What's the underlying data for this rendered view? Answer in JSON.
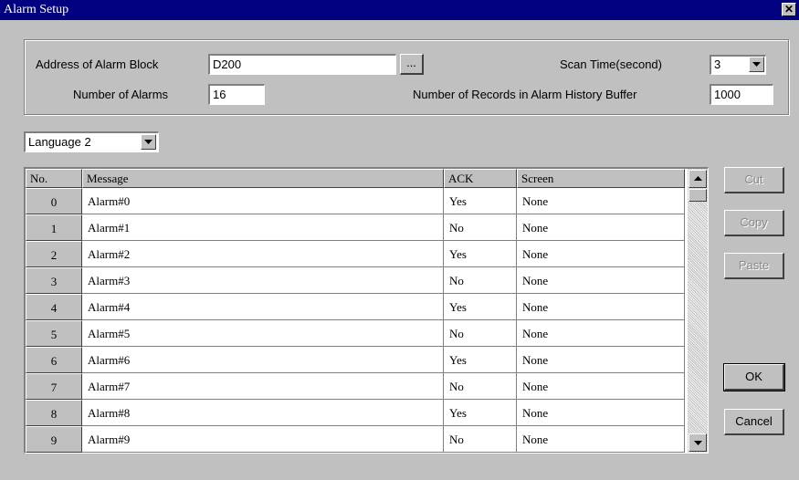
{
  "window": {
    "title": "Alarm Setup",
    "close_glyph": "✕"
  },
  "settings": {
    "address_label": "Address of Alarm Block",
    "address_value": "D200",
    "browse_label": "...",
    "scan_time_label": "Scan Time(second)",
    "scan_time_value": "3",
    "num_alarms_label": "Number of Alarms",
    "num_alarms_value": "16",
    "history_label": "Number of Records in Alarm History Buffer",
    "history_value": "1000"
  },
  "language": {
    "selected": "Language 2"
  },
  "table": {
    "columns": [
      "No.",
      "Message",
      "ACK",
      "Screen"
    ],
    "rows": [
      {
        "no": "0",
        "message": "Alarm#0",
        "ack": "Yes",
        "screen": "None"
      },
      {
        "no": "1",
        "message": "Alarm#1",
        "ack": "No",
        "screen": "None"
      },
      {
        "no": "2",
        "message": "Alarm#2",
        "ack": "Yes",
        "screen": "None"
      },
      {
        "no": "3",
        "message": "Alarm#3",
        "ack": "No",
        "screen": "None"
      },
      {
        "no": "4",
        "message": "Alarm#4",
        "ack": "Yes",
        "screen": "None"
      },
      {
        "no": "5",
        "message": "Alarm#5",
        "ack": "No",
        "screen": "None"
      },
      {
        "no": "6",
        "message": "Alarm#6",
        "ack": "Yes",
        "screen": "None"
      },
      {
        "no": "7",
        "message": "Alarm#7",
        "ack": "No",
        "screen": "None"
      },
      {
        "no": "8",
        "message": "Alarm#8",
        "ack": "Yes",
        "screen": "None"
      },
      {
        "no": "9",
        "message": "Alarm#9",
        "ack": "No",
        "screen": "None"
      }
    ]
  },
  "buttons": {
    "cut": "Cut",
    "copy": "Copy",
    "paste": "Paste",
    "ok": "OK",
    "cancel": "Cancel"
  },
  "colors": {
    "titlebar": "#000080",
    "face": "#c0c0c0"
  }
}
